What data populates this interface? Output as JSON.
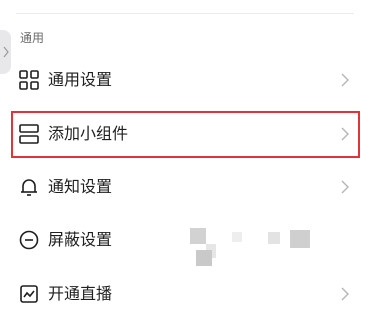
{
  "section": {
    "title": "通用"
  },
  "rows": [
    {
      "label": "通用设置",
      "icon": "grid-icon"
    },
    {
      "label": "添加小组件",
      "icon": "widget-icon"
    },
    {
      "label": "通知设置",
      "icon": "bell-icon"
    },
    {
      "label": "屏蔽设置",
      "icon": "block-icon"
    },
    {
      "label": "开通直播",
      "icon": "live-icon"
    }
  ],
  "colors": {
    "highlight": "#e0333a",
    "text": "#1f1f1f",
    "section_title": "#6b6b6b",
    "chevron": "#b5b5b5"
  }
}
